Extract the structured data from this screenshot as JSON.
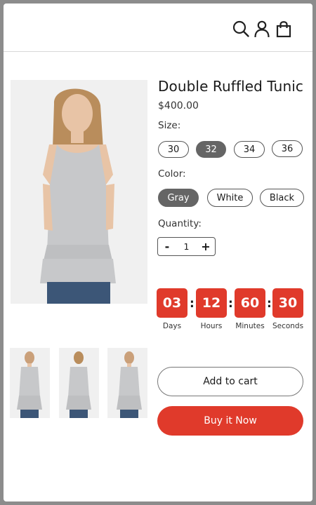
{
  "header": {
    "icons": [
      "search-icon",
      "user-icon",
      "shopping-bag-icon"
    ]
  },
  "product": {
    "title": "Double Ruffled Tunic",
    "price": "$400.00",
    "color_shown": "#cfd0d2"
  },
  "size": {
    "label": "Size:",
    "options": [
      "30",
      "32",
      "34",
      "36"
    ],
    "selected": "32"
  },
  "color": {
    "label": "Color:",
    "options": [
      "Gray",
      "White",
      "Black"
    ],
    "selected": "Gray"
  },
  "quantity": {
    "label": "Quantity:",
    "minus": "-",
    "value": "1",
    "plus": "+"
  },
  "countdown": {
    "days": "03",
    "days_label": "Days",
    "hours": "12",
    "hours_label": "Hours",
    "minutes": "60",
    "minutes_label": "Minutes",
    "seconds": "30",
    "seconds_label": "Seconds",
    "separator": ":"
  },
  "actions": {
    "add_to_cart": "Add to cart",
    "buy_now": "Buy it Now"
  },
  "colors": {
    "accent": "#e03a2b",
    "selected_pill": "#656565"
  }
}
